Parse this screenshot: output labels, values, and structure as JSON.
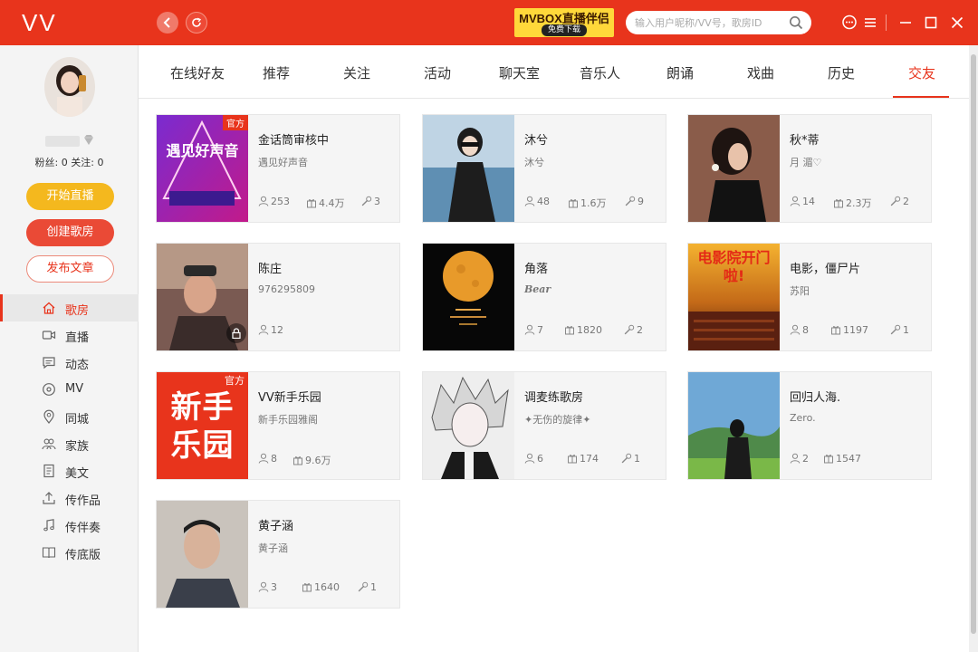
{
  "app": {
    "logo": "VV"
  },
  "promo": {
    "title": "MVBOX直播伴侣",
    "button": "免费下载"
  },
  "search": {
    "placeholder": "输入用户昵称/VV号，歌房ID"
  },
  "user": {
    "fans_text": "粉丝: 0 关注: 0"
  },
  "actions": {
    "start_live": "开始直播",
    "create_room": "创建歌房",
    "post_article": "发布文章"
  },
  "menu": [
    {
      "label": "歌房",
      "icon": "home-icon",
      "active": true
    },
    {
      "label": "直播",
      "icon": "video-camera-icon"
    },
    {
      "label": "动态",
      "icon": "chat-bubble-icon"
    },
    {
      "label": "MV",
      "icon": "disc-icon"
    },
    {
      "label": "同城",
      "icon": "location-pin-icon"
    },
    {
      "label": "家族",
      "icon": "group-icon"
    },
    {
      "label": "美文",
      "icon": "document-icon"
    },
    {
      "label": "传作品",
      "icon": "upload-icon"
    },
    {
      "label": "传伴奏",
      "icon": "music-note-icon"
    },
    {
      "label": "传底版",
      "icon": "book-icon"
    }
  ],
  "tabs": [
    "在线好友",
    "推荐",
    "关注",
    "活动",
    "聊天室",
    "音乐人",
    "朗诵",
    "戏曲",
    "历史",
    "交友"
  ],
  "active_tab": "交友",
  "rooms": [
    {
      "name": "金话筒审核中",
      "desc": "遇见好声音",
      "users": "253",
      "gifts": "4.4万",
      "mics": "3",
      "thumb_text": "遇见好声音",
      "badge": "官方"
    },
    {
      "name": "沐兮",
      "desc": "沐兮",
      "users": "48",
      "gifts": "1.6万",
      "mics": "9"
    },
    {
      "name": "秋*蒂",
      "desc": "月 湄♡",
      "users": "14",
      "gifts": "2.3万",
      "mics": "2"
    },
    {
      "name": "陈庄",
      "desc": "976295809",
      "users": "12",
      "locked": true
    },
    {
      "name": "角落",
      "desc": "Bear",
      "users": "7",
      "gifts": "1820",
      "mics": "2"
    },
    {
      "name": "电影，僵尸片",
      "desc": "苏阳",
      "users": "8",
      "gifts": "1197",
      "mics": "1",
      "thumb_text": "电影院开门啦!"
    },
    {
      "name": "VV新手乐园",
      "desc": "新手乐园雅阁",
      "users": "8",
      "gifts": "9.6万",
      "thumb_text": "新手乐园",
      "badge": "官方"
    },
    {
      "name": "调麦练歌房",
      "desc": "✦无伤的旋律✦",
      "users": "6",
      "gifts": "174",
      "mics": "1"
    },
    {
      "name": "回归人海.",
      "desc": "Zero.",
      "users": "2",
      "gifts": "1547"
    },
    {
      "name": "黄子涵",
      "desc": "黄子涵",
      "users": "3",
      "gifts": "1640",
      "mics": "1"
    }
  ],
  "colors": {
    "brand_red": "#e8341c",
    "live_yellow": "#f4b81e",
    "sidebar_bg": "#f4f4f4",
    "card_bg": "#f5f5f5"
  }
}
